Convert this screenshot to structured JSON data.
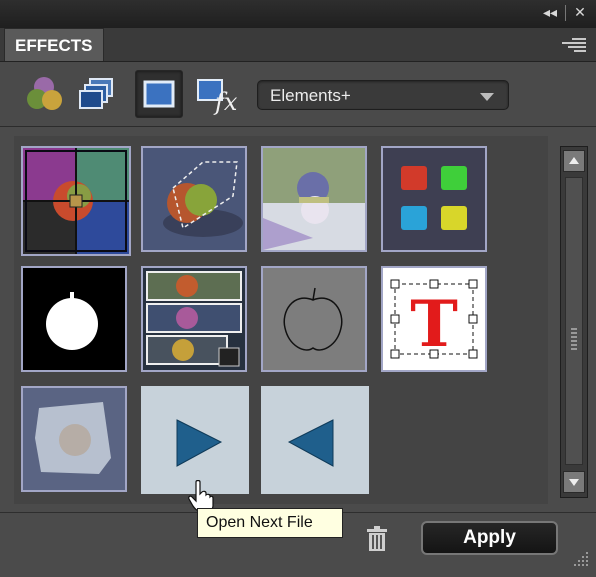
{
  "panel": {
    "title_tab": "EFFECTS",
    "collapse_label": "◂◂",
    "close_label": "✕"
  },
  "toolbar": {
    "buttons": [
      {
        "name": "layer-styles-icon"
      },
      {
        "name": "photo-effects-icon"
      },
      {
        "name": "filters-icon",
        "selected": true
      },
      {
        "name": "all-effects-fx-icon"
      }
    ],
    "category": {
      "selected": "Elements+",
      "icon": "chevron-down-icon"
    }
  },
  "thumbnails": [
    {
      "name": "four-quadrant-color-effect",
      "selected": true
    },
    {
      "name": "apple-selection-effect"
    },
    {
      "name": "reflection-effect"
    },
    {
      "name": "color-buttons-effect"
    },
    {
      "name": "apple-mask-silhouette-effect"
    },
    {
      "name": "stacked-photos-effect"
    },
    {
      "name": "apple-outline-effect"
    },
    {
      "name": "text-transform-effect",
      "letter": "T"
    },
    {
      "name": "frosted-ice-effect"
    },
    {
      "name": "next-file-arrow",
      "icon": "play-right-icon"
    },
    {
      "name": "previous-file-arrow",
      "icon": "play-left-icon"
    }
  ],
  "tooltip": {
    "text": "Open Next File"
  },
  "footer": {
    "apply_label": "Apply"
  },
  "colors": {
    "panel_bg": "#4b4b4b",
    "thumb_border": "#a2a6c6",
    "tooltip_bg": "#ffffe1",
    "arrow_blue": "#1f5f8c"
  }
}
